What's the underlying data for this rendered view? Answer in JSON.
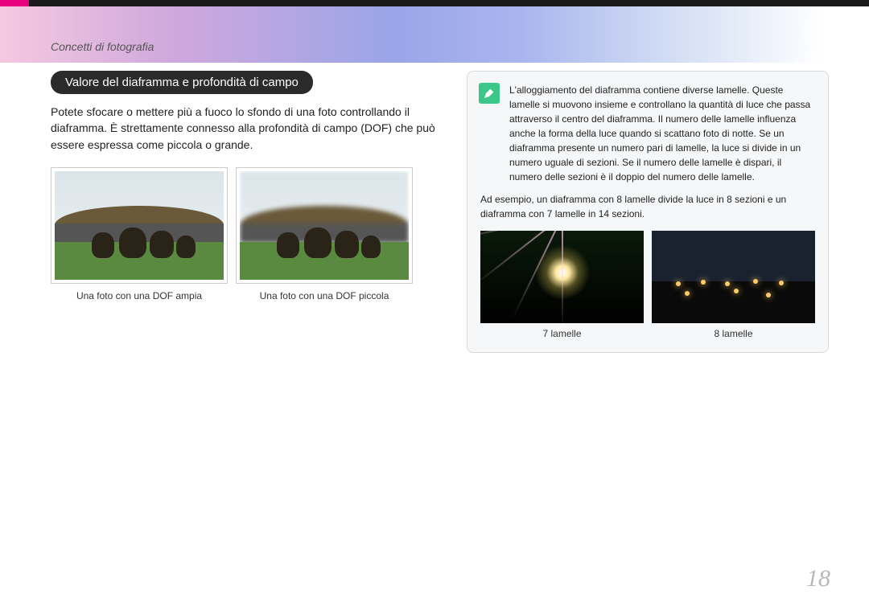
{
  "breadcrumb": "Concetti di fotografia",
  "section_title": "Valore del diaframma e profondità di campo",
  "body_text": "Potete sfocare o mettere più a fuoco lo sfondo di una foto controllando il diaframma. È strettamente connesso alla profondità di campo (DOF) che può essere espressa come piccola o grande.",
  "photos": [
    {
      "caption": "Una foto con una DOF ampia"
    },
    {
      "caption": "Una foto con una DOF piccola"
    }
  ],
  "note": {
    "p1": "L'alloggiamento del diaframma contiene diverse lamelle. Queste lamelle si muovono insieme e controllano la quantità di luce che passa attraverso il centro del diaframma. Il numero delle lamelle influenza anche la forma della luce quando si scattano foto di notte. Se un diaframma presente un numero pari di lamelle, la luce si divide in un numero uguale di sezioni. Se il numero delle lamelle è dispari, il numero delle sezioni è il doppio del numero delle lamelle.",
    "p2": "Ad esempio, un diaframma con 8 lamelle divide la luce in 8 sezioni e un diaframma con 7 lamelle in 14 sezioni.",
    "examples": [
      {
        "caption": "7 lamelle"
      },
      {
        "caption": "8 lamelle"
      }
    ]
  },
  "page_number": "18"
}
